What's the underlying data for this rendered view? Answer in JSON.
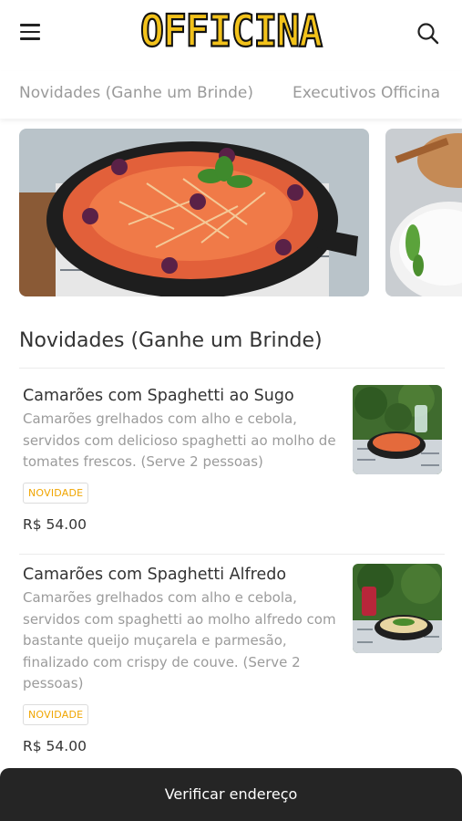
{
  "header": {
    "logo_text": "OFFICINA",
    "menu_icon": "hamburger-menu-icon",
    "search_icon": "search-icon"
  },
  "tabs": [
    {
      "label": "Novidades (Ganhe um Brinde)"
    },
    {
      "label": "Executivos Officina"
    }
  ],
  "section": {
    "title": "Novidades (Ganhe um Brinde)"
  },
  "items": [
    {
      "name": "Camarões com Spaghetti ao Sugo",
      "description": "Camarões grelhados com alho e cebola, servidos com delicioso spaghetti ao molho de tomates frescos. (Serve 2 pessoas)",
      "badge": "NOVIDADE",
      "price": "R$ 54.00"
    },
    {
      "name": "Camarões com Spaghetti Alfredo",
      "description": "Camarões grelhados com alho e cebola, servidos com spaghetti ao molho alfredo com bastante queijo muçarela e parmesão, finalizado com crispy de couve. (Serve 2 pessoas)",
      "badge": "NOVIDADE",
      "price": "R$ 54.00"
    }
  ],
  "bottom_bar": {
    "label": "Verificar endereço"
  },
  "colors": {
    "logo_yellow": "#f2c21b",
    "badge_orange": "#f0a500",
    "bottom_bar": "#252525"
  }
}
